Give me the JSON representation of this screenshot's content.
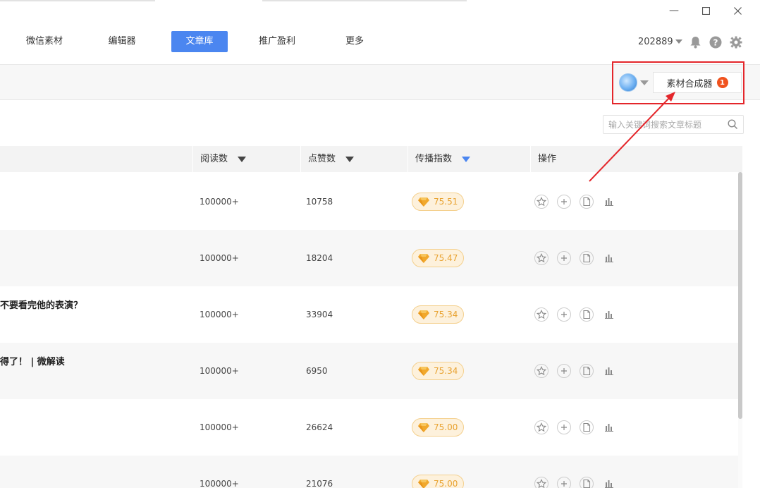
{
  "window": {
    "minimize_label": "—",
    "maximize_label": "☐",
    "close_label": "✕"
  },
  "nav": {
    "items": [
      {
        "label": "微信素材"
      },
      {
        "label": "编辑器"
      },
      {
        "label": "文章库"
      },
      {
        "label": "推广盈利"
      },
      {
        "label": "更多"
      }
    ],
    "active_index": 2
  },
  "header": {
    "user_id": "202889",
    "icons": [
      "bell-icon",
      "help-icon",
      "gear-icon"
    ]
  },
  "toolbar": {
    "merge_label": "素材合成器",
    "merge_badge": "1"
  },
  "search": {
    "placeholder": "输入关键词搜索文章标题"
  },
  "table": {
    "columns": [
      {
        "label": "阅读数"
      },
      {
        "label": "点赞数"
      },
      {
        "label": "传播指数"
      },
      {
        "label": "操作"
      }
    ],
    "rows": [
      {
        "title": "",
        "reads": "100000+",
        "likes": "10758",
        "score": "75.51"
      },
      {
        "title": "",
        "reads": "100000+",
        "likes": "18204",
        "score": "75.47"
      },
      {
        "title": "不要看完他的表演？",
        "reads": "100000+",
        "likes": "33904",
        "score": "75.34"
      },
      {
        "title": "得了！ | 微解读",
        "reads": "100000+",
        "likes": "6950",
        "score": "75.34"
      },
      {
        "title": "",
        "reads": "100000+",
        "likes": "26624",
        "score": "75.00"
      },
      {
        "title": "",
        "reads": "100000+",
        "likes": "21076",
        "score": "75.00"
      }
    ]
  },
  "colors": {
    "accent": "#4b86f0",
    "badge": "#f0521e",
    "highlight": "#e4262b",
    "score_text": "#e8a230"
  }
}
